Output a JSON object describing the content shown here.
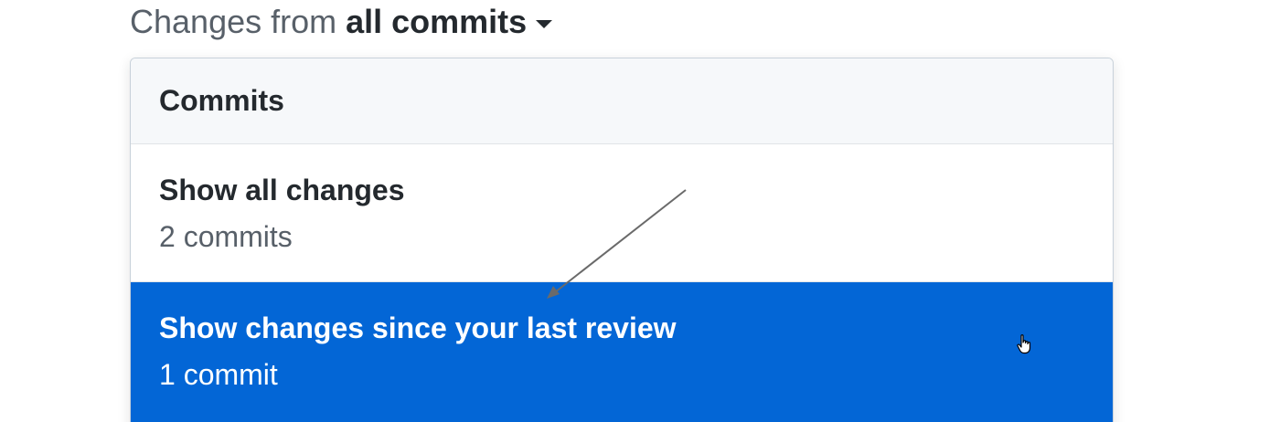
{
  "toggle": {
    "prefix": "Changes from",
    "selection": "all commits",
    "icon": "caret-down-icon"
  },
  "dropdown": {
    "header": "Commits",
    "items": [
      {
        "title": "Show all changes",
        "subtitle": "2 commits",
        "selected": false
      },
      {
        "title": "Show changes since your last review",
        "subtitle": "1 commit",
        "selected": true
      }
    ]
  },
  "annotation": {
    "type": "arrow-icon",
    "color": "#6a6a6a"
  },
  "cursor": {
    "icon": "hand-pointer-icon"
  },
  "colors": {
    "accent": "#0366d6",
    "header_bg": "#f6f8fa",
    "text_primary": "#24292e",
    "text_muted": "#586069"
  }
}
